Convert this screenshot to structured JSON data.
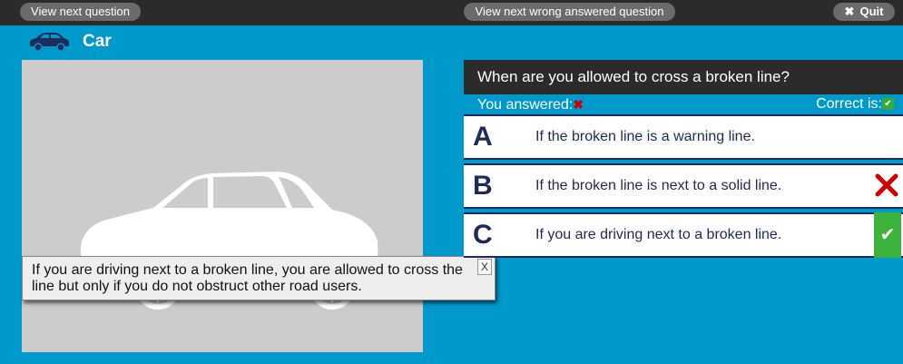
{
  "toolbar": {
    "next_label": "View next question",
    "next_wrong_label": "View next wrong answered question",
    "quit_label": "Quit"
  },
  "category": {
    "label": "Car",
    "icon": "car-icon"
  },
  "question": {
    "text": "When are you allowed to cross a broken line?",
    "you_answered_label": "You answered:",
    "correct_is_label": "Correct is:"
  },
  "options": [
    {
      "letter": "A",
      "text": "If the broken line is a warning line."
    },
    {
      "letter": "B",
      "text": "If the broken line is next to a solid line.",
      "status": "wrong"
    },
    {
      "letter": "C",
      "text": "If you are driving next to a broken line.",
      "status": "correct"
    }
  ],
  "explanation": {
    "text": "If you are driving next to a broken line, you are allowed to cross the line but only if you do not obstruct other road users.",
    "close_label": "X"
  },
  "colors": {
    "background": "#0099cc",
    "topbar": "#2b2b2b",
    "navy": "#1d2a5a",
    "correct": "#3bb33b",
    "wrong": "#cc0000"
  }
}
